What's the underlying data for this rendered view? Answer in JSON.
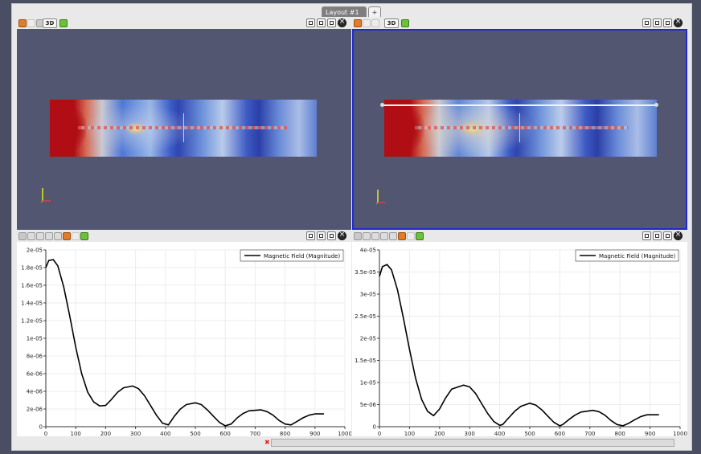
{
  "layout_tabs": [
    {
      "label": "Layout #1",
      "active": true
    },
    {
      "label": "+",
      "active": false
    }
  ],
  "view_toolbar": {
    "mode_label": "3D"
  },
  "render_views": [
    {
      "name": "left-render-view",
      "selected": false,
      "has_probe_line": false
    },
    {
      "name": "right-render-view",
      "selected": true,
      "has_probe_line": true
    }
  ],
  "colors": {
    "background_3d": "#525671",
    "selected_border": "#1f2ad6",
    "plot_line": "#000000"
  },
  "chart_data": [
    {
      "type": "line",
      "title": "",
      "xlabel": "",
      "ylabel": "",
      "xlim": [
        0,
        1000
      ],
      "ylim": [
        0,
        2e-05
      ],
      "x_ticks": [
        "0",
        "100",
        "200",
        "300",
        "400",
        "500",
        "600",
        "700",
        "800",
        "900",
        "1000"
      ],
      "y_ticks": [
        "0",
        "2e-06",
        "4e-06",
        "6e-06",
        "8e-06",
        "1e-05",
        "1.2e-05",
        "1.4e-05",
        "1.6e-05",
        "1.8e-05",
        "2e-05"
      ],
      "legend_position": "top-right",
      "series": [
        {
          "name": "Magnetic Field (Magnitude)",
          "x": [
            0,
            10,
            25,
            40,
            60,
            80,
            100,
            120,
            140,
            160,
            180,
            200,
            220,
            240,
            260,
            290,
            310,
            330,
            350,
            370,
            390,
            410,
            430,
            450,
            470,
            500,
            520,
            540,
            560,
            580,
            600,
            620,
            640,
            660,
            680,
            720,
            740,
            760,
            780,
            800,
            820,
            840,
            860,
            880,
            900,
            930
          ],
          "y": [
            1.8e-05,
            1.88e-05,
            1.89e-05,
            1.82e-05,
            1.58e-05,
            1.25e-05,
            9e-06,
            6e-06,
            3.9e-06,
            2.8e-06,
            2.35e-06,
            2.4e-06,
            3.1e-06,
            3.9e-06,
            4.4e-06,
            4.6e-06,
            4.3e-06,
            3.5e-06,
            2.4e-06,
            1.3e-06,
            4e-07,
            2e-07,
            1.2e-06,
            2e-06,
            2.5e-06,
            2.7e-06,
            2.5e-06,
            1.9e-06,
            1.2e-06,
            5e-07,
            1e-07,
            3e-07,
            1e-06,
            1.5e-06,
            1.8e-06,
            1.9e-06,
            1.7e-06,
            1.3e-06,
            7e-07,
            3e-07,
            2e-07,
            6e-07,
            1e-06,
            1.3e-06,
            1.45e-06,
            1.45e-06
          ]
        }
      ]
    },
    {
      "type": "line",
      "title": "",
      "xlabel": "",
      "ylabel": "",
      "xlim": [
        0,
        1000
      ],
      "ylim": [
        0,
        4e-05
      ],
      "x_ticks": [
        "0",
        "100",
        "200",
        "300",
        "400",
        "500",
        "600",
        "700",
        "800",
        "900",
        "1000"
      ],
      "y_ticks": [
        "0",
        "5e-06",
        "1e-05",
        "1.5e-05",
        "2e-05",
        "2.5e-05",
        "3e-05",
        "3.5e-05",
        "4e-05"
      ],
      "legend_position": "top-right",
      "series": [
        {
          "name": "Magnetic Field (Magnitude)",
          "x": [
            0,
            10,
            25,
            40,
            60,
            80,
            100,
            120,
            140,
            160,
            180,
            200,
            220,
            240,
            280,
            300,
            320,
            340,
            360,
            380,
            400,
            410,
            430,
            450,
            470,
            500,
            520,
            540,
            560,
            580,
            600,
            610,
            630,
            650,
            670,
            710,
            730,
            750,
            770,
            790,
            810,
            830,
            850,
            870,
            890,
            930
          ],
          "y": [
            3.4e-05,
            3.62e-05,
            3.67e-05,
            3.55e-05,
            3.1e-05,
            2.45e-05,
            1.75e-05,
            1.1e-05,
            6.2e-06,
            3.5e-06,
            2.5e-06,
            4e-06,
            6.5e-06,
            8.5e-06,
            9.4e-06,
            9e-06,
            7.5e-06,
            5.2e-06,
            3e-06,
            1.2e-06,
            3e-07,
            5e-07,
            2e-06,
            3.5e-06,
            4.6e-06,
            5.3e-06,
            4.9e-06,
            3.8e-06,
            2.4e-06,
            1e-06,
            2e-07,
            5e-07,
            1.6e-06,
            2.6e-06,
            3.3e-06,
            3.7e-06,
            3.4e-06,
            2.6e-06,
            1.4e-06,
            5e-07,
            2e-07,
            8e-07,
            1.6e-06,
            2.3e-06,
            2.7e-06,
            2.7e-06
          ]
        }
      ]
    }
  ]
}
